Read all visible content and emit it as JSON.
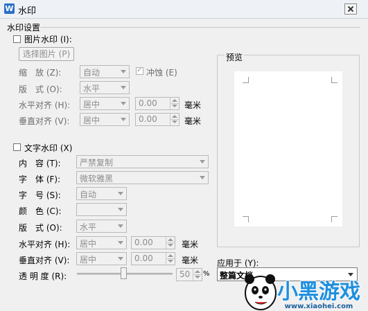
{
  "window": {
    "title": "水印",
    "app_icon": "W"
  },
  "group": {
    "label": "水印设置"
  },
  "picture": {
    "checkbox_label": "图片水印 (I):",
    "select_button": "选择图片 (P)",
    "scale_label": "缩　放 (Z):",
    "scale_value": "自动",
    "washout_label": "冲蚀 (E)",
    "layout_label": "版　式 (O):",
    "layout_value": "水平",
    "halign_label": "水平对齐 (H):",
    "halign_value": "居中",
    "halign_offset": "0.00",
    "valign_label": "垂直对齐 (V):",
    "valign_value": "居中",
    "valign_offset": "0.00",
    "unit": "毫米"
  },
  "text": {
    "checkbox_label": "文字水印 (X)",
    "content_label": "内　容 (T):",
    "content_value": "严禁复制",
    "font_label": "字　体 (F):",
    "font_value": "微软雅黑",
    "size_label": "字　号 (S):",
    "size_value": "自动",
    "color_label": "颜　色 (C):",
    "layout_label": "版　式 (O):",
    "layout_value": "水平",
    "halign_label": "水平对齐 (H):",
    "halign_value": "居中",
    "halign_offset": "0.00",
    "valign_label": "垂直对齐 (V):",
    "valign_value": "居中",
    "valign_offset": "0.00",
    "unit": "毫米",
    "transparency_label": "透 明 度 (R):",
    "transparency_value": "50",
    "transparency_unit": "%"
  },
  "preview": {
    "label": "预览"
  },
  "apply": {
    "label": "应用于 (Y):",
    "value": "整篇文档"
  },
  "watermark_logo": {
    "text": "小黑游戏",
    "url_text": "www.xiaohei.com"
  }
}
